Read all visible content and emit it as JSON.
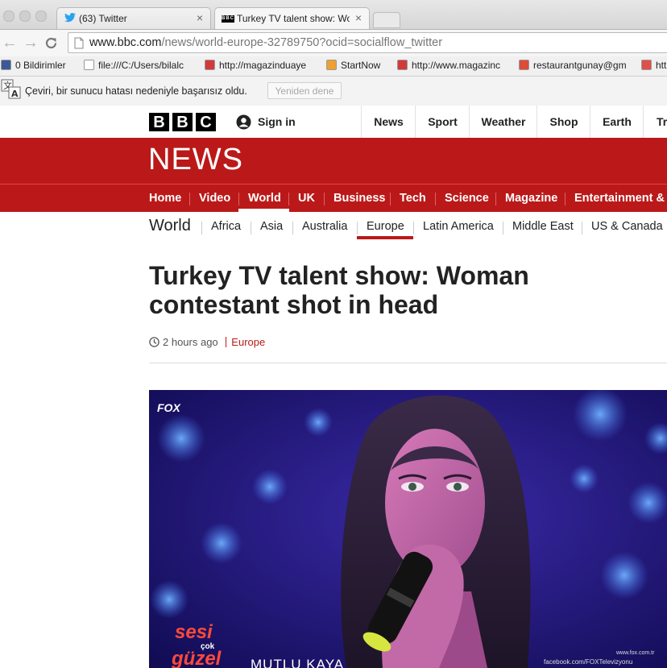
{
  "browser": {
    "tabs": [
      {
        "title": "(63) Twitter",
        "icon": "twitter-bird-icon"
      },
      {
        "title": "Turkey TV talent show: Wom",
        "icon": "bbc-favicon"
      }
    ],
    "url_host": "www.bbc.com",
    "url_rest": "/news/world-europe-32789750?ocid=socialflow_twitter",
    "bookmarks": [
      {
        "label": "0 Bildirimler",
        "icon": "facebook-icon",
        "color": "#3b5998"
      },
      {
        "label": "file:///C:/Users/bilalc",
        "icon": "document-icon",
        "color": "#ffffff"
      },
      {
        "label": "http://magazinduaye",
        "icon": "site-favicon",
        "color": "#d23a3a"
      },
      {
        "label": "StartNow",
        "icon": "startnow-icon",
        "color": "#f0a030"
      },
      {
        "label": "http://www.magazinc",
        "icon": "site-favicon",
        "color": "#d23a3a"
      },
      {
        "label": "restaurantgunay@gm",
        "icon": "google-plus-icon",
        "color": "#dd4b39"
      },
      {
        "label": "htt",
        "icon": "site-favicon",
        "color": "#e0504a"
      }
    ]
  },
  "translate_bar": {
    "message": "Çeviri, bir sunucu hatası nedeniyle başarısız oldu.",
    "retry": "Yeniden dene"
  },
  "bbc": {
    "blocks": [
      "B",
      "B",
      "C"
    ],
    "sign_in": "Sign in",
    "top_nav": [
      "News",
      "Sport",
      "Weather",
      "Shop",
      "Earth",
      "Tr"
    ],
    "news_logo": "NEWS",
    "sections": [
      "Home",
      "Video",
      "World",
      "UK",
      "Business",
      "Tech",
      "Science",
      "Magazine",
      "Entertainment & Ar"
    ],
    "world_title": "World",
    "world_nav": [
      "Africa",
      "Asia",
      "Australia",
      "Europe",
      "Latin America",
      "Middle East",
      "US & Canada"
    ]
  },
  "article": {
    "headline": "Turkey TV talent show: Woman contestant shot in head",
    "time": "2 hours ago",
    "category": "Europe"
  },
  "image_overlay": {
    "channel": "FOX",
    "show_logo_line1": "sesi",
    "show_logo_line2": "çok",
    "show_logo_line3": "güzel",
    "name_caption": "MUTLU KAYA",
    "site": "www.fox.com.tr",
    "facebook": "facebook.com/FOXTelevizyonu"
  },
  "colors": {
    "bbc_red": "#bb1919"
  }
}
